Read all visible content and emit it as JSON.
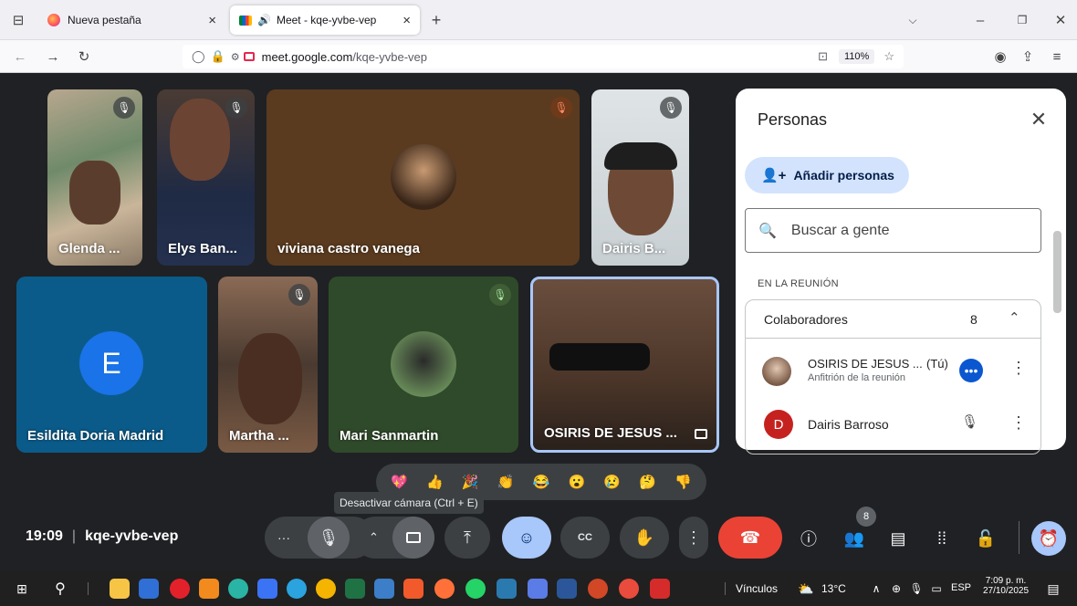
{
  "browser": {
    "tabs": [
      {
        "title": "Nueva pestaña",
        "close": "×"
      },
      {
        "title": "Meet - kqe-yvbe-vep",
        "close": "×"
      }
    ],
    "new_tab": "+",
    "url_host": "meet.google.com",
    "url_path": "/kqe-yvbe-vep",
    "zoom": "110%"
  },
  "tiles": [
    {
      "name": "Glenda ...",
      "muted": true
    },
    {
      "name": "Elys Ban...",
      "muted": true
    },
    {
      "name": "viviana castro vanega",
      "muted": true
    },
    {
      "name": "Dairis B...",
      "muted": true
    },
    {
      "name": "Esildita Doria Madrid",
      "initial": "E",
      "muted": false
    },
    {
      "name": "Martha ...",
      "muted": true
    },
    {
      "name": "Mari Sanmartin",
      "muted": true
    },
    {
      "name": "OSIRIS DE JESUS ...",
      "muted": false
    }
  ],
  "panel": {
    "title": "Personas",
    "add_people": "Añadir personas",
    "search_placeholder": "Buscar a gente",
    "section": "EN LA REUNIÓN",
    "group_label": "Colaboradores",
    "group_count": "8",
    "people": [
      {
        "name": "OSIRIS DE JESUS ...",
        "suffix": "(Tú)",
        "role": "Anfitrión de la reunión"
      },
      {
        "name": "Dairis Barroso",
        "initial": "D",
        "role": ""
      }
    ]
  },
  "tooltip": "Desactivar cámara (Ctrl + E)",
  "footer": {
    "time": "19:09",
    "meeting_code": "kqe-yvbe-vep",
    "people_badge": "8"
  },
  "reactions": [
    "💖",
    "👍",
    "🎉",
    "👏",
    "😂",
    "😮",
    "😢",
    "🤔",
    "👎"
  ],
  "taskbar": {
    "links_label": "Vínculos",
    "weather": "13°C",
    "lang": "ESP",
    "clock_time": "7:09 p. m.",
    "clock_date": "27/10/2025"
  },
  "colors": {
    "accent_blue": "#8ab4f8",
    "end_call_red": "#ea4335",
    "active_tile_border": "#a8c7fa"
  }
}
